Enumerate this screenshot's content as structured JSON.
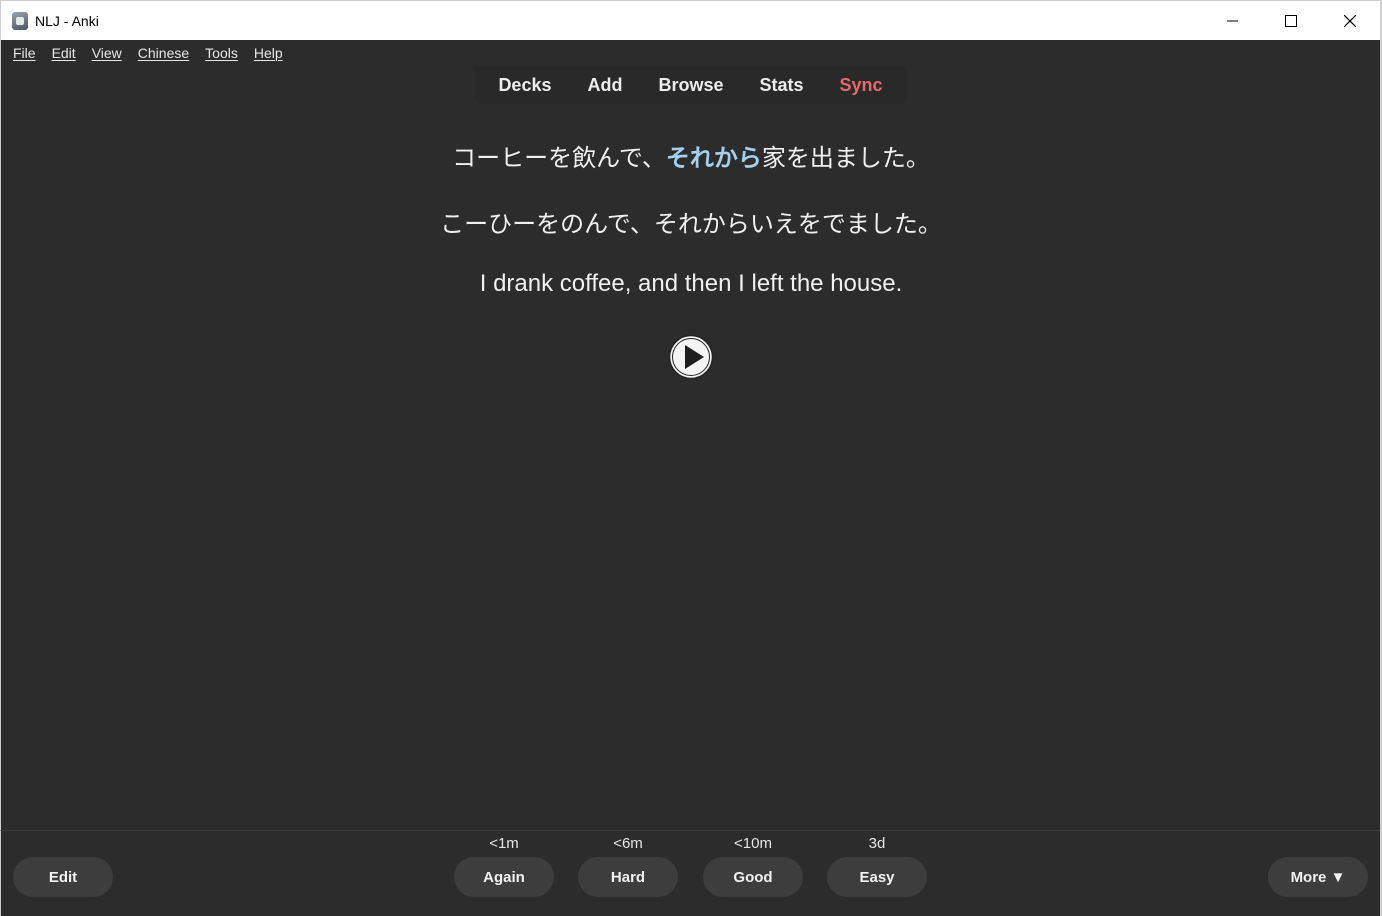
{
  "window": {
    "title": "NLJ - Anki",
    "icon": "anki-app-icon"
  },
  "menubar": {
    "items": [
      "File",
      "Edit",
      "View",
      "Chinese",
      "Tools",
      "Help"
    ]
  },
  "toptabs": {
    "items": [
      "Decks",
      "Add",
      "Browse",
      "Stats",
      "Sync"
    ],
    "sync_color": "#e8696a"
  },
  "card": {
    "jp_before": "コーヒーを飲んで、",
    "jp_highlight": "それから",
    "jp_after": "家を出ました。",
    "kana": "こーひーをのんで、それからいえをでました。",
    "english": "I drank coffee, and then I left the house.",
    "highlight_color": "#a3d0ec",
    "play_icon": "play-icon"
  },
  "bottombar": {
    "edit_label": "Edit",
    "answers": [
      {
        "interval": "<1m",
        "label": "Again"
      },
      {
        "interval": "<6m",
        "label": "Hard"
      },
      {
        "interval": "<10m",
        "label": "Good"
      },
      {
        "interval": "3d",
        "label": "Easy"
      }
    ],
    "more_label": "More ▼"
  }
}
